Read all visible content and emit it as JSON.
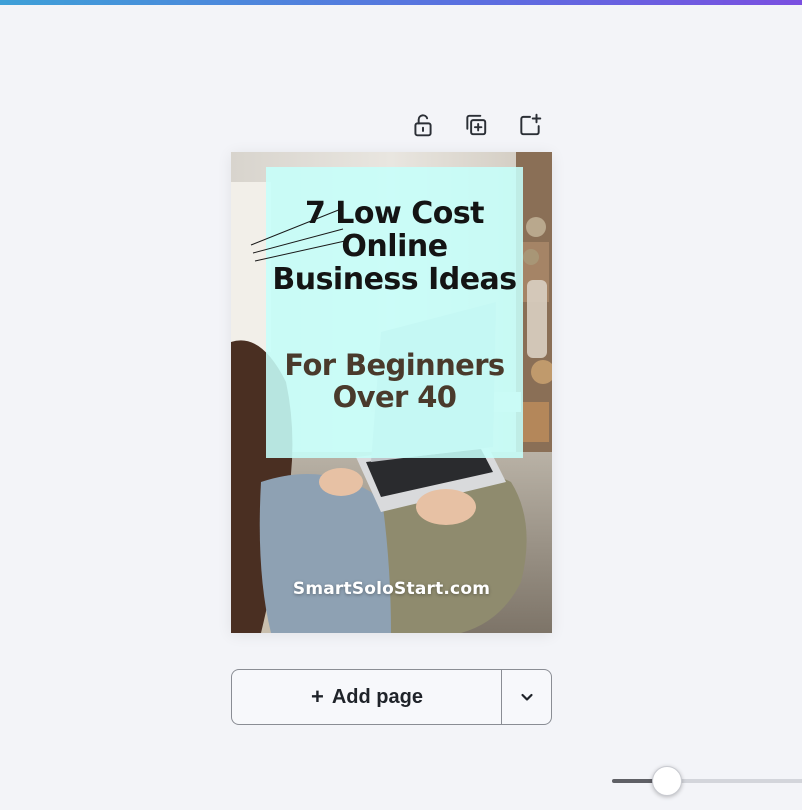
{
  "design": {
    "headline": "7 Low Cost Online Business Ideas",
    "subheadline": "For Beginners Over 40",
    "website": "SmartSoloStart.com"
  },
  "page_tools": {
    "icons": [
      "lock-open-icon",
      "duplicate-page-icon",
      "add-page-icon"
    ]
  },
  "add_page": {
    "label": "Add page",
    "plus": "+"
  },
  "zoom": {
    "level_fraction": 0.29
  },
  "colors": {
    "overlay": "#c6fffb",
    "headline": "#141414",
    "subheadline": "#4a3a2c",
    "accent_gradient_start": "#3ea0d8",
    "accent_gradient_end": "#7a4fe0"
  }
}
